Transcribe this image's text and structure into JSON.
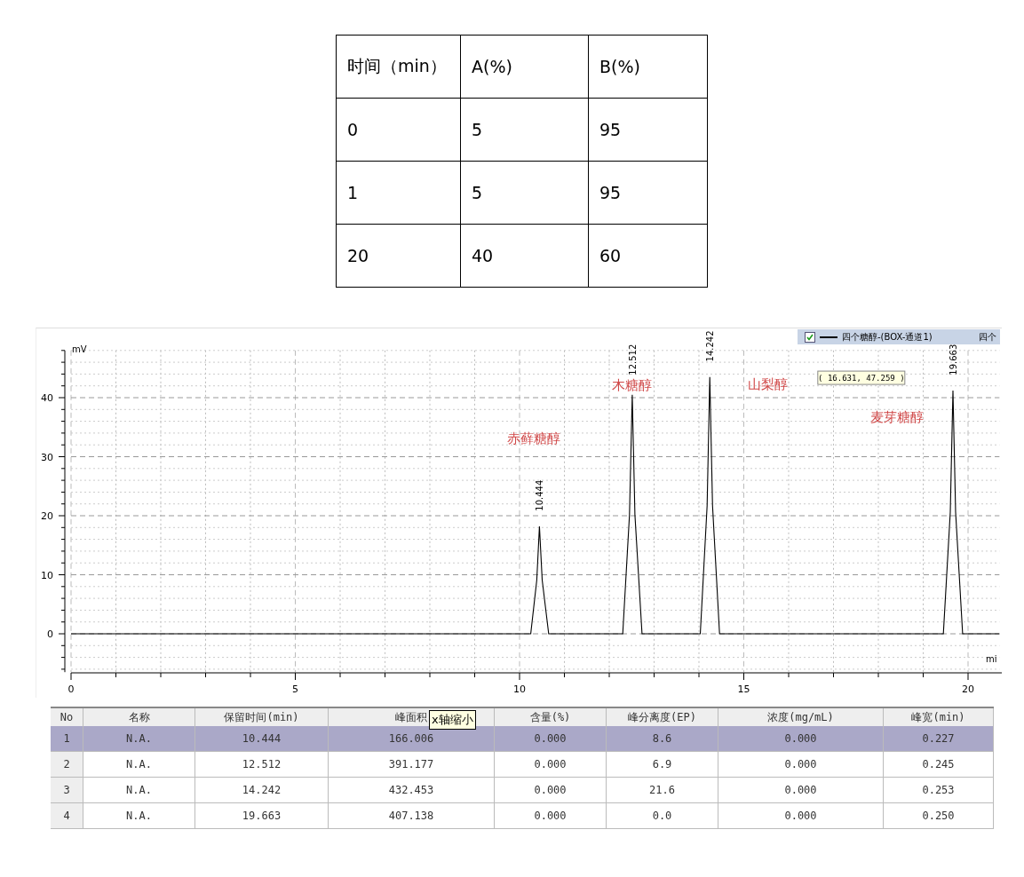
{
  "gradient_table": {
    "columns": [
      "时间（min）",
      "A(%)",
      "B(%)"
    ],
    "rows": [
      [
        "0",
        "5",
        "95"
      ],
      [
        "1",
        "5",
        "95"
      ],
      [
        "20",
        "40",
        "60"
      ]
    ]
  },
  "chromatogram": {
    "legend": [
      {
        "checked": true
      },
      {
        "label": "四个"
      }
    ],
    "tooltip": "( 16.631, 47.259 )",
    "peak_labels": [
      {
        "rt": "10.444",
        "name": "赤藓糖醇"
      },
      {
        "rt": "12.512",
        "name": "木糖醇"
      },
      {
        "rt": "14.242",
        "name": "山梨醇"
      },
      {
        "rt": "19.663",
        "name": "麦芽糖醇"
      }
    ],
    "chart_data": {
      "type": "line",
      "ylabel": "mV",
      "xlabel": "mi",
      "xlim": [
        0,
        20.7
      ],
      "ylim": [
        -6.5,
        48
      ],
      "xticks": [
        0,
        5,
        10,
        15,
        20
      ],
      "yticks": [
        0,
        10,
        20,
        30,
        40
      ],
      "grid": true,
      "x": [
        0,
        10.25,
        10.384,
        10.444,
        10.504,
        10.65,
        12.3,
        12.452,
        12.512,
        12.572,
        12.73,
        14.03,
        14.182,
        14.242,
        14.302,
        14.46,
        19.45,
        19.603,
        19.663,
        19.723,
        19.88,
        20.7
      ],
      "series": [
        {
          "name": "四个糖醇-(BOX-通道1)",
          "color": "#000000",
          "values": [
            0,
            0,
            9.1,
            18.2,
            9.1,
            0,
            0,
            20.2,
            40.5,
            20.2,
            0,
            0,
            21.7,
            43.5,
            21.7,
            0,
            0,
            20.6,
            41.2,
            20.6,
            0,
            0
          ]
        }
      ]
    }
  },
  "peak_table": {
    "columns": [
      "No",
      "名称",
      "保留时间(min)",
      "峰面积",
      "含量(%)",
      "峰分离度(EP)",
      "浓度(mg/mL)",
      "峰宽(min)"
    ],
    "tooltip": "x轴缩小",
    "rows": [
      {
        "selected": true,
        "cells": [
          "1",
          "N.A.",
          "10.444",
          "166.006",
          "0.000",
          "8.6",
          "0.000",
          "0.227"
        ]
      },
      {
        "selected": false,
        "cells": [
          "2",
          "N.A.",
          "12.512",
          "391.177",
          "0.000",
          "6.9",
          "0.000",
          "0.245"
        ]
      },
      {
        "selected": false,
        "cells": [
          "3",
          "N.A.",
          "14.242",
          "432.453",
          "0.000",
          "21.6",
          "0.000",
          "0.253"
        ]
      },
      {
        "selected": false,
        "cells": [
          "4",
          "N.A.",
          "19.663",
          "407.138",
          "0.000",
          "0.0",
          "0.000",
          "0.250"
        ]
      }
    ]
  }
}
